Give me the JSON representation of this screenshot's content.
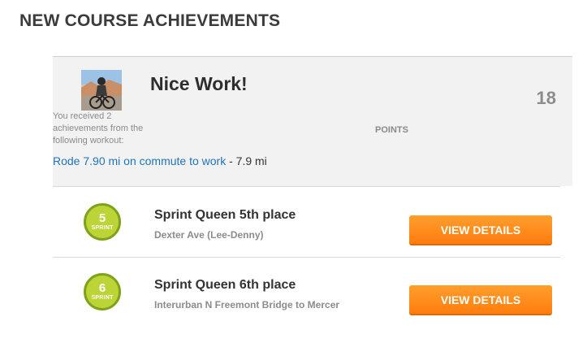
{
  "page": {
    "title": "NEW COURSE ACHIEVEMENTS"
  },
  "summary": {
    "heading": "Nice Work!",
    "message": "You received 2 achievements from the following workout:",
    "points_value": "18",
    "points_label": "POINTS",
    "activity_link": "Rode 7.90 mi on commute to work",
    "activity_suffix": " - 7.9 mi",
    "avatar_icon": "cyclist-photo"
  },
  "achievements": [
    {
      "badge_number": "5",
      "badge_label": "SPRINT",
      "name": "Sprint Queen 5th place",
      "segment": "Dexter Ave (Lee-Denny)",
      "button_label": "VIEW DETAILS"
    },
    {
      "badge_number": "6",
      "badge_label": "SPRINT",
      "name": "Sprint Queen 6th place",
      "segment": "Interurban N Freemont Bridge to Mercer",
      "button_label": "VIEW DETAILS"
    }
  ],
  "colors": {
    "badge_fill": "#bdd437",
    "badge_border": "#7ea21a",
    "button_orange": "#ff8a1a",
    "link_blue": "#1e74b8"
  }
}
